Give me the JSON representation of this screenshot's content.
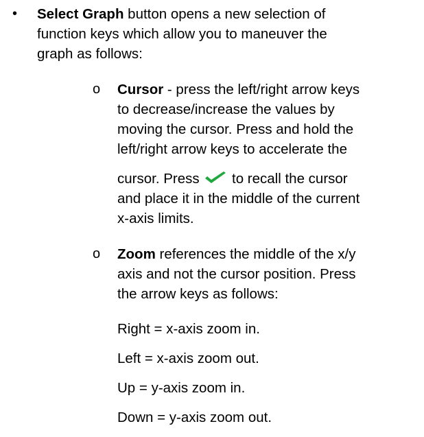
{
  "bullet_glyph": "•",
  "sub_bullet_glyph": "o",
  "select_graph": {
    "term": "Select Graph",
    "line1_rest": " button opens a new selection of",
    "line2": "function keys which allow you to maneuver the",
    "line3": "graph as follows:"
  },
  "cursor_item": {
    "term": "Cursor",
    "line1_rest": " - press the left/right arrow keys",
    "line2": "to decrease/increase the values by",
    "line3": "moving the cursor. Press and hold the",
    "line4": "left/right arrow keys to accelerate the",
    "line5_before": "cursor. Press ",
    "check_icon": "checkmark-icon",
    "check_color": "#1fa83d",
    "line5_after": " to recall the cursor",
    "line6": "and place it in the middle of the current",
    "line7": "x-axis limits."
  },
  "zoom_item": {
    "term": "Zoom",
    "line1_rest": " references the middle of the x/y",
    "line2": "axis and not the cursor position. Press",
    "line3": "the arrow keys as follows:",
    "keys": [
      "Right = x-axis zoom in.",
      "Left = x-axis zoom out.",
      "Up = y-axis zoom in.",
      "Down = y-axis zoom out."
    ]
  }
}
